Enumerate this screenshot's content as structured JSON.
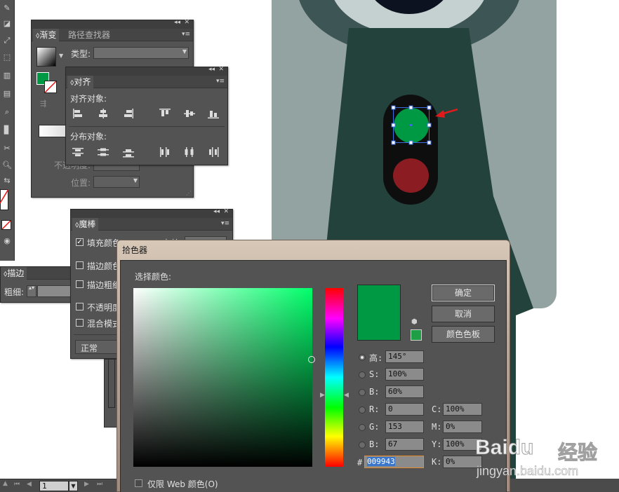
{
  "gradient_panel": {
    "tab_gradient": "渐变",
    "tab_pathfinder": "路径查找器",
    "type_label": "类型:",
    "opacity_label": "不透明度:",
    "position_label": "位置:"
  },
  "align_panel": {
    "tab": "对齐",
    "align_objects_label": "对齐对象:",
    "distribute_objects_label": "分布对象:"
  },
  "magic_wand_panel": {
    "tab": "魔棒",
    "fill_color": "填充颜色",
    "tolerance_label": "容差",
    "stroke_color": "描边颜色",
    "stroke_weight": "描边粗细",
    "opacity": "不透明度",
    "blend_mode": "混合模式",
    "blend_value": "正常"
  },
  "stroke_panel": {
    "tab": "描边",
    "weight_label": "粗细:"
  },
  "color_picker": {
    "title": "拾色器",
    "select_color_label": "选择颜色:",
    "ok_button": "确定",
    "cancel_button": "取消",
    "swatches_button": "颜色色板",
    "web_only_label": "仅限 Web 颜色(O)",
    "current_color": "#009943",
    "channels": {
      "h": {
        "label": "高:",
        "value": "145°"
      },
      "s": {
        "label": "S:",
        "value": "100%"
      },
      "b": {
        "label": "B:",
        "value": "60%"
      },
      "r": {
        "label": "R:",
        "value": "0"
      },
      "g": {
        "label": "G:",
        "value": "153"
      },
      "b2": {
        "label": "B:",
        "value": "67"
      },
      "c": {
        "label": "C:",
        "value": "100%"
      },
      "m": {
        "label": "M:",
        "value": "0%"
      },
      "y": {
        "label": "Y:",
        "value": "100%"
      },
      "k": {
        "label": "K:",
        "value": "0%"
      }
    },
    "hex_label": "#",
    "hex_value": "009943"
  },
  "statusbar": {
    "page_value": "1"
  },
  "watermark": {
    "brand": "Baidu",
    "suffix": "经验",
    "url": "jingyan.baidu.com"
  },
  "colors": {
    "panel_bg": "#535353",
    "selected_green": "#009943",
    "artwork_red": "#8b1d22",
    "selection_blue": "#3d6fe0",
    "arrow_red": "#e11b1b"
  }
}
